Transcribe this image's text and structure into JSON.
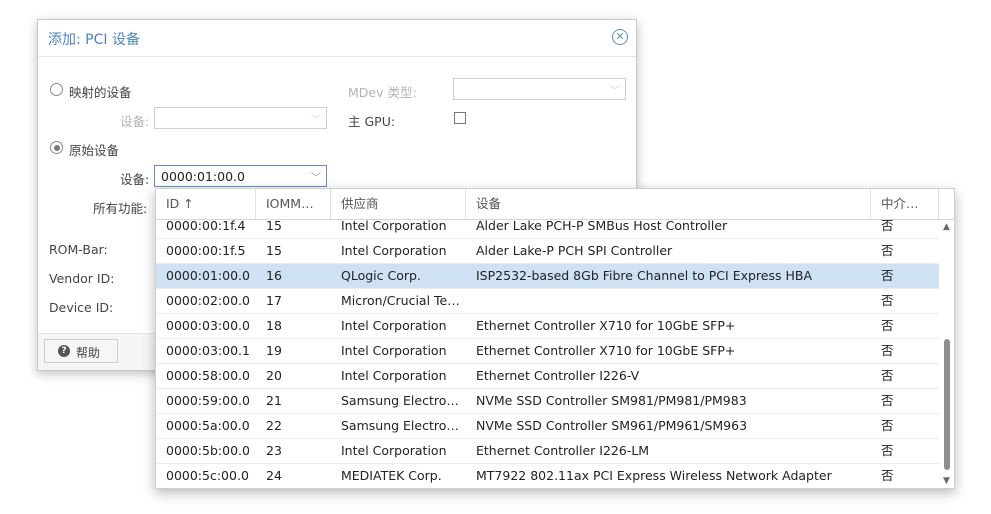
{
  "dialog": {
    "title": "添加: PCI 设备",
    "mapped_device_label": "映射的设备",
    "mapped_device_field_label": "设备:",
    "mdev_type_label": "MDev 类型:",
    "primary_gpu_label": "主 GPU:",
    "raw_device_label": "原始设备",
    "raw_device_field_label": "设备:",
    "raw_device_value": "0000:01:00.0",
    "all_functions_label": "所有功能:",
    "rombar_label": "ROM-Bar:",
    "vendor_id_label": "Vendor ID:",
    "device_id_label": "Device ID:",
    "help_button": "帮助",
    "mapped_selected": false,
    "raw_selected": true,
    "primary_gpu_checked": false
  },
  "grid": {
    "columns": [
      "ID ↑",
      "IOMM…",
      "供应商",
      "设备",
      "中介…"
    ],
    "rows": [
      {
        "id": "0000:00:1f.4",
        "iommu": "15",
        "vendor": "Intel Corporation",
        "device": "Alder Lake PCH-P SMBus Host Controller",
        "mdev": "否"
      },
      {
        "id": "0000:00:1f.5",
        "iommu": "15",
        "vendor": "Intel Corporation",
        "device": "Alder Lake-P PCH SPI Controller",
        "mdev": "否"
      },
      {
        "id": "0000:01:00.0",
        "iommu": "16",
        "vendor": "QLogic Corp.",
        "device": "ISP2532-based 8Gb Fibre Channel to PCI Express HBA",
        "mdev": "否",
        "selected": true
      },
      {
        "id": "0000:02:00.0",
        "iommu": "17",
        "vendor": "Micron/Crucial Te…",
        "device": "",
        "mdev": "否"
      },
      {
        "id": "0000:03:00.0",
        "iommu": "18",
        "vendor": "Intel Corporation",
        "device": "Ethernet Controller X710 for 10GbE SFP+",
        "mdev": "否"
      },
      {
        "id": "0000:03:00.1",
        "iommu": "19",
        "vendor": "Intel Corporation",
        "device": "Ethernet Controller X710 for 10GbE SFP+",
        "mdev": "否"
      },
      {
        "id": "0000:58:00.0",
        "iommu": "20",
        "vendor": "Intel Corporation",
        "device": "Ethernet Controller I226-V",
        "mdev": "否"
      },
      {
        "id": "0000:59:00.0",
        "iommu": "21",
        "vendor": "Samsung Electro…",
        "device": "NVMe SSD Controller SM981/PM981/PM983",
        "mdev": "否"
      },
      {
        "id": "0000:5a:00.0",
        "iommu": "22",
        "vendor": "Samsung Electro…",
        "device": "NVMe SSD Controller SM961/PM961/SM963",
        "mdev": "否"
      },
      {
        "id": "0000:5b:00.0",
        "iommu": "23",
        "vendor": "Intel Corporation",
        "device": "Ethernet Controller I226-LM",
        "mdev": "否"
      },
      {
        "id": "0000:5c:00.0",
        "iommu": "24",
        "vendor": "MEDIATEK Corp.",
        "device": "MT7922 802.11ax PCI Express Wireless Network Adapter",
        "mdev": "否"
      }
    ]
  },
  "icons": {
    "close": "close-circle-icon",
    "combo_trigger": "chevron-down-icon",
    "help": "question-circle-icon",
    "scroll_up": "triangle-up-icon",
    "scroll_down": "triangle-down-icon"
  },
  "colors": {
    "title": "#4a86c5",
    "selected_row": "#cfe2f3",
    "focus_border": "#5b8fd1"
  }
}
